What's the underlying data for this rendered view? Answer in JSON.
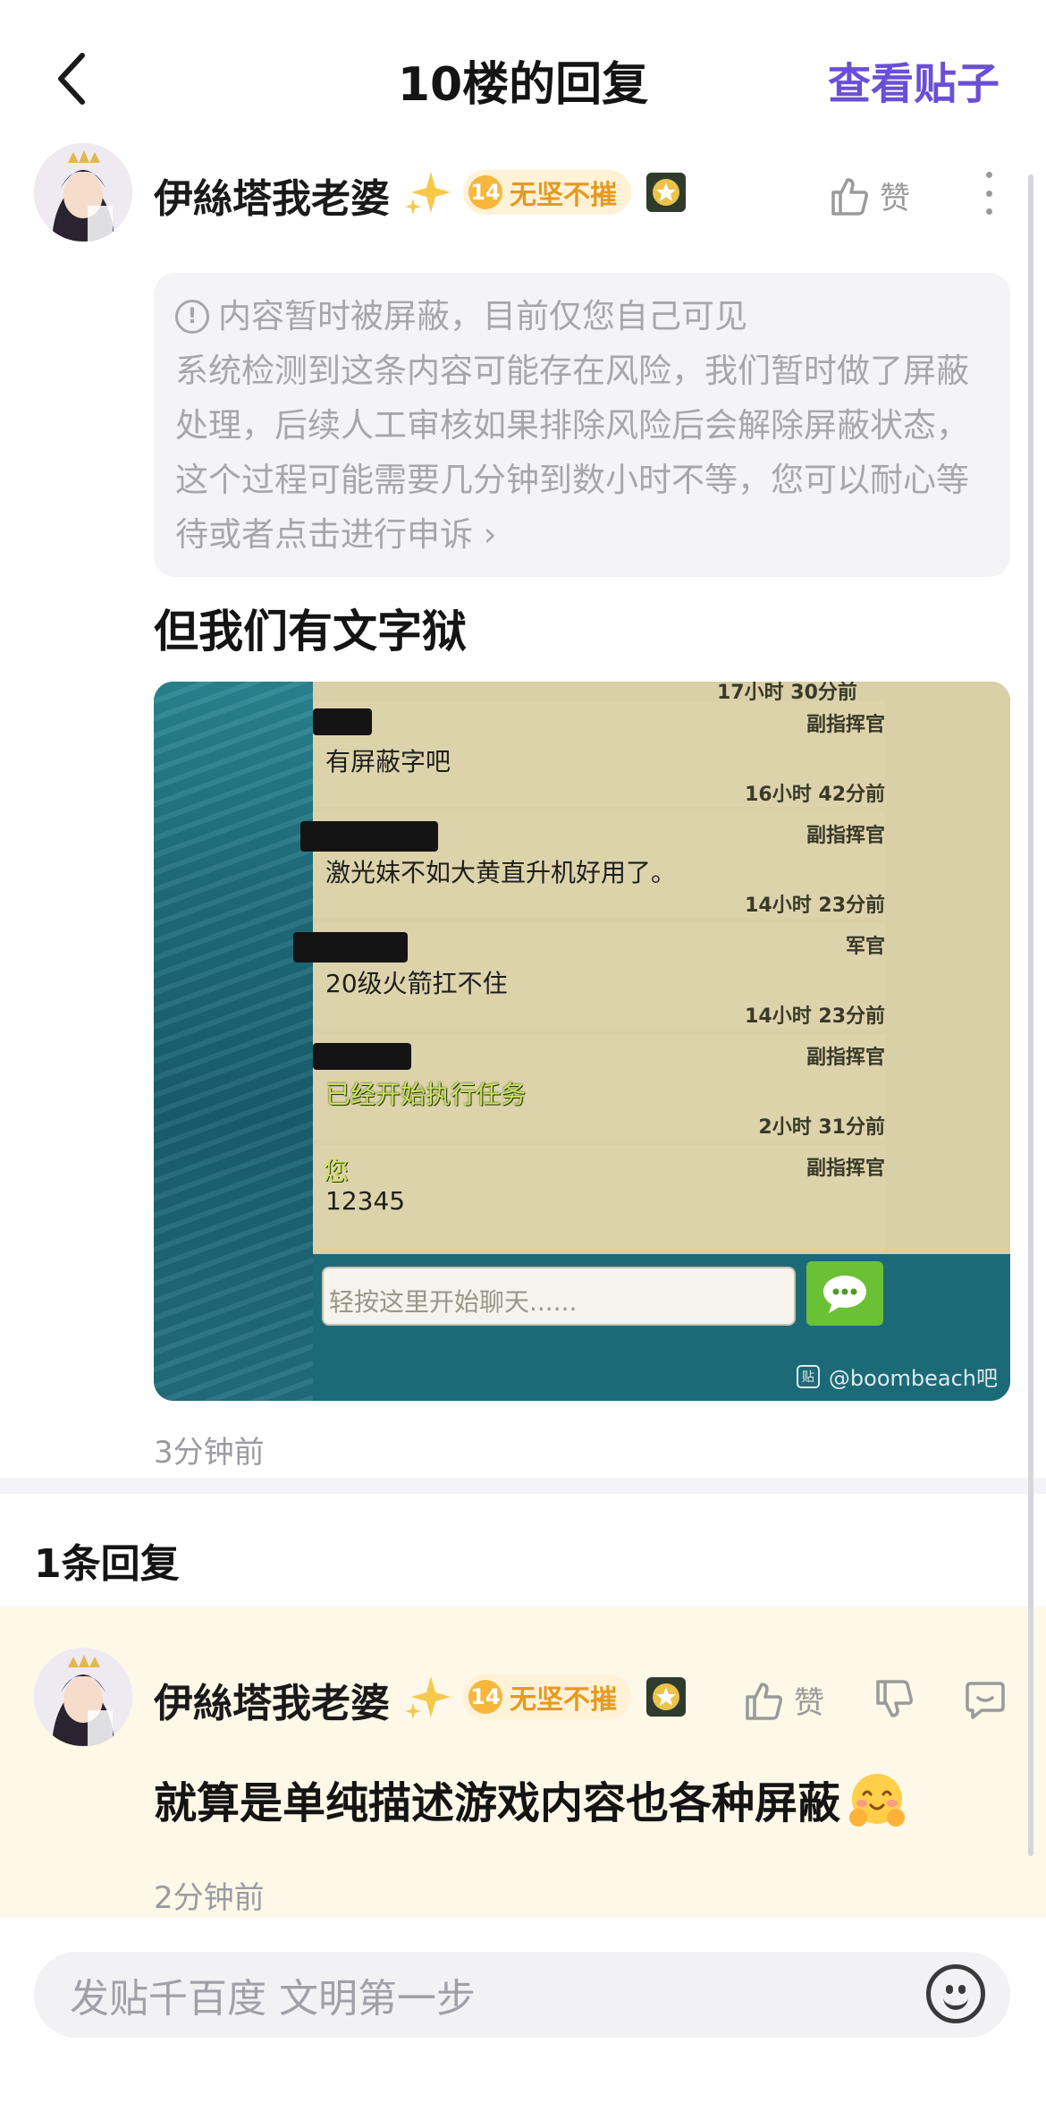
{
  "header": {
    "back_icon": "chevron-left-icon",
    "title": "10楼的回复",
    "view_post_label": "查看贴子",
    "accent_color": "#6a4fd6"
  },
  "post": {
    "username": "伊絲塔我老婆",
    "level": "14",
    "badge_text": "无坚不摧",
    "like_label": "赞",
    "notice": {
      "title": "内容暂时被屏蔽，目前仅您自己可见",
      "body": "系统检测到这条内容可能存在风险，我们暂时做了屏蔽处理，后续人工审核如果排除风险后会解除屏蔽状态，这个过程可能需要几分钟到数小时不等，您可以耐心等待或者点击进行申诉",
      "appeal_chevron": "›"
    },
    "text": "但我们有文字狱",
    "image": {
      "top_time": "17小时 30分前",
      "messages": [
        {
          "role": "副指挥官",
          "body": "有屏蔽字吧",
          "time": "16小时 42分前"
        },
        {
          "role": "副指挥官",
          "body": "激光妹不如大黄直升机好用了。",
          "time": "14小时 23分前"
        },
        {
          "role": "军官",
          "body": "20级火箭扛不住",
          "time": "14小时 23分前"
        },
        {
          "role": "副指挥官",
          "body": "已经开始执行任务",
          "time": "2小时 31分前"
        },
        {
          "role": "副指挥官",
          "sender": "您",
          "body": "12345",
          "time": ""
        }
      ],
      "input_placeholder": "轻按这里开始聊天......",
      "watermark_icon": "贴",
      "watermark": "@boombeach吧"
    },
    "timestamp": "3分钟前"
  },
  "replies": {
    "count_label": "1条回复",
    "items": [
      {
        "username": "伊絲塔我老婆",
        "level": "14",
        "badge_text": "无坚不摧",
        "like_label": "赞",
        "text": "就算是单纯描述游戏内容也各种屏蔽",
        "timestamp": "2分钟前"
      }
    ]
  },
  "composer": {
    "placeholder": "发贴千百度 文明第一步",
    "emoji_icon": "smiley-icon"
  }
}
